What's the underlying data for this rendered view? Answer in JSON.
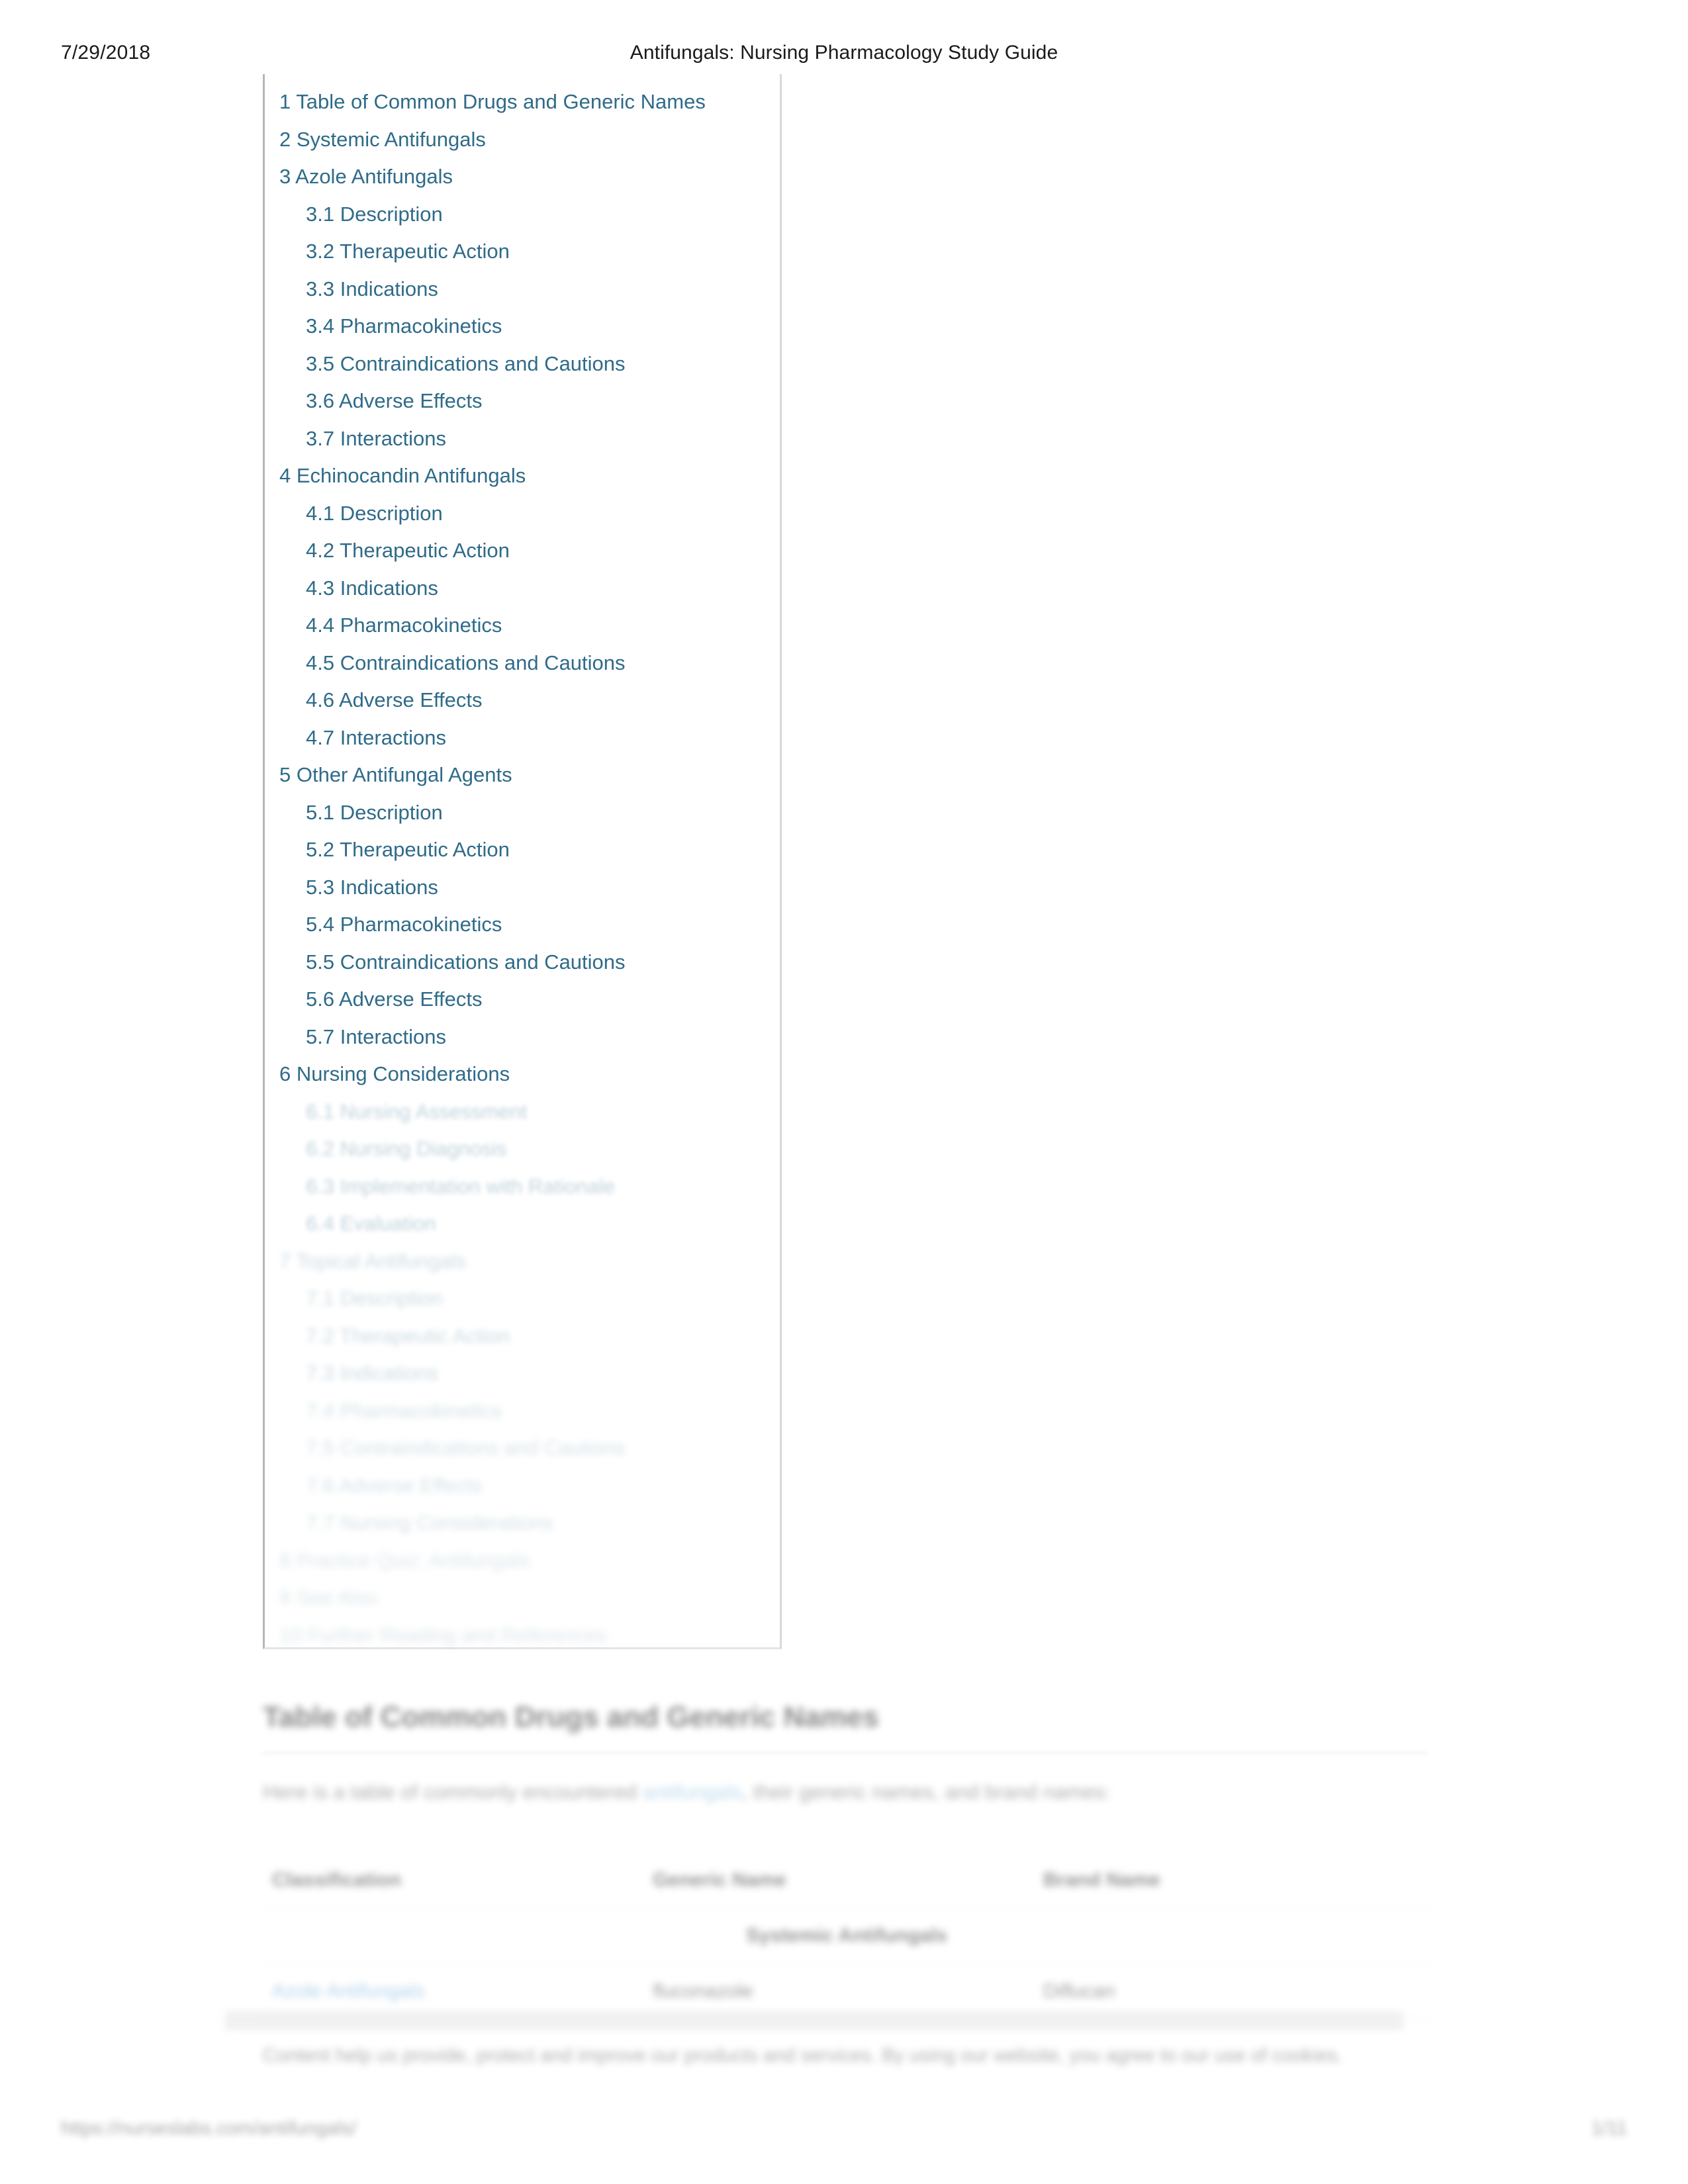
{
  "print_header": {
    "date": "7/29/2018",
    "title": "Antifungals: Nursing Pharmacology Study Guide"
  },
  "toc": {
    "items": [
      {
        "label": "1 Table of Common Drugs and Generic Names",
        "level": 1
      },
      {
        "label": "2 Systemic Antifungals",
        "level": 1
      },
      {
        "label": "3 Azole Antifungals",
        "level": 1
      },
      {
        "label": "3.1 Description",
        "level": 2
      },
      {
        "label": "3.2 Therapeutic Action",
        "level": 2
      },
      {
        "label": "3.3 Indications",
        "level": 2
      },
      {
        "label": "3.4 Pharmacokinetics",
        "level": 2
      },
      {
        "label": "3.5 Contraindications and Cautions",
        "level": 2
      },
      {
        "label": "3.6 Adverse Effects",
        "level": 2
      },
      {
        "label": "3.7 Interactions",
        "level": 2
      },
      {
        "label": "4 Echinocandin Antifungals",
        "level": 1
      },
      {
        "label": "4.1 Description",
        "level": 2
      },
      {
        "label": "4.2 Therapeutic Action",
        "level": 2
      },
      {
        "label": "4.3 Indications",
        "level": 2
      },
      {
        "label": "4.4 Pharmacokinetics",
        "level": 2
      },
      {
        "label": "4.5 Contraindications and Cautions",
        "level": 2
      },
      {
        "label": "4.6 Adverse Effects",
        "level": 2
      },
      {
        "label": "4.7 Interactions",
        "level": 2
      },
      {
        "label": "5 Other Antifungal Agents",
        "level": 1
      },
      {
        "label": "5.1 Description",
        "level": 2
      },
      {
        "label": "5.2 Therapeutic Action",
        "level": 2
      },
      {
        "label": "5.3 Indications",
        "level": 2
      },
      {
        "label": "5.4 Pharmacokinetics",
        "level": 2
      },
      {
        "label": "5.5 Contraindications and Cautions",
        "level": 2
      },
      {
        "label": "5.6 Adverse Effects",
        "level": 2
      },
      {
        "label": "5.7 Interactions",
        "level": 2
      },
      {
        "label": "6 Nursing Considerations",
        "level": 1
      },
      {
        "label": "6.1 Nursing Assessment",
        "level": 2
      },
      {
        "label": "6.2 Nursing Diagnosis",
        "level": 2
      },
      {
        "label": "6.3 Implementation with Rationale",
        "level": 2
      },
      {
        "label": "6.4 Evaluation",
        "level": 2
      },
      {
        "label": "7 Topical Antifungals",
        "level": 1
      },
      {
        "label": "7.1 Description",
        "level": 2
      },
      {
        "label": "7.2 Therapeutic Action",
        "level": 2
      },
      {
        "label": "7.3 Indications",
        "level": 2
      },
      {
        "label": "7.4 Pharmacokinetics",
        "level": 2
      },
      {
        "label": "7.5 Contraindications and Cautions",
        "level": 2
      },
      {
        "label": "7.6 Adverse Effects",
        "level": 2
      },
      {
        "label": "7.7 Nursing Considerations",
        "level": 2
      },
      {
        "label": "8 Practice Quiz: Antifungals",
        "level": 1
      },
      {
        "label": "9 See Also",
        "level": 1
      },
      {
        "label": "10 Further Reading and References",
        "level": 1
      }
    ]
  },
  "main": {
    "heading": "Table of Common Drugs and Generic Names",
    "paragraph_before_link": "Here is a table of commonly encountered ",
    "paragraph_link": "antifungals",
    "paragraph_after_link": ", their generic names, and brand names:"
  },
  "table": {
    "columns": [
      "Classification",
      "Generic Name",
      "Brand Name"
    ],
    "group_row": "Systemic Antifungals",
    "rows": [
      {
        "classification": "Azole Antifungals",
        "generic": "fluconazole",
        "brand": "Diflucan"
      }
    ]
  },
  "footer": {
    "note": "Content help us provide, protect and improve our products and services. By using our website, you agree to our use of cookies.",
    "url": "https://nurseslabs.com/antifungals/",
    "page": "1/11"
  },
  "colors": {
    "link": "#2f6b89",
    "inline_link": "#63a7d4",
    "text": "#1a1a1a",
    "rule": "#e8e8e8",
    "toc_border": "#b6b6b6"
  }
}
